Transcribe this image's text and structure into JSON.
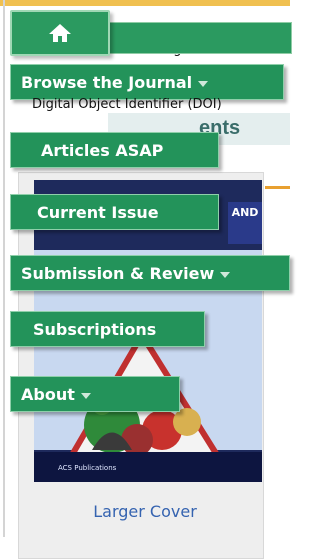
{
  "background": {
    "page_label": "Page:",
    "doi_label": "Digital Object Identifier (DOI)",
    "heading_fragment": "ents"
  },
  "nav": {
    "home_icon": "home-icon",
    "items": [
      {
        "label": "Browse the Journal",
        "has_dropdown": true
      },
      {
        "label": "Articles ASAP",
        "has_dropdown": false
      },
      {
        "label": "Current Issue",
        "has_dropdown": false
      },
      {
        "label": "Submission & Review",
        "has_dropdown": true
      },
      {
        "label": "Subscriptions",
        "has_dropdown": false
      },
      {
        "label": "About",
        "has_dropdown": true
      }
    ]
  },
  "cover": {
    "title_fragment": "AND",
    "publisher": "ACS Publications",
    "link_label": "Larger Cover"
  },
  "colors": {
    "nav_green": "#23935a",
    "nav_border": "#8fcfaa",
    "link_blue": "#3563b0",
    "accent_orange": "#e8a030"
  }
}
